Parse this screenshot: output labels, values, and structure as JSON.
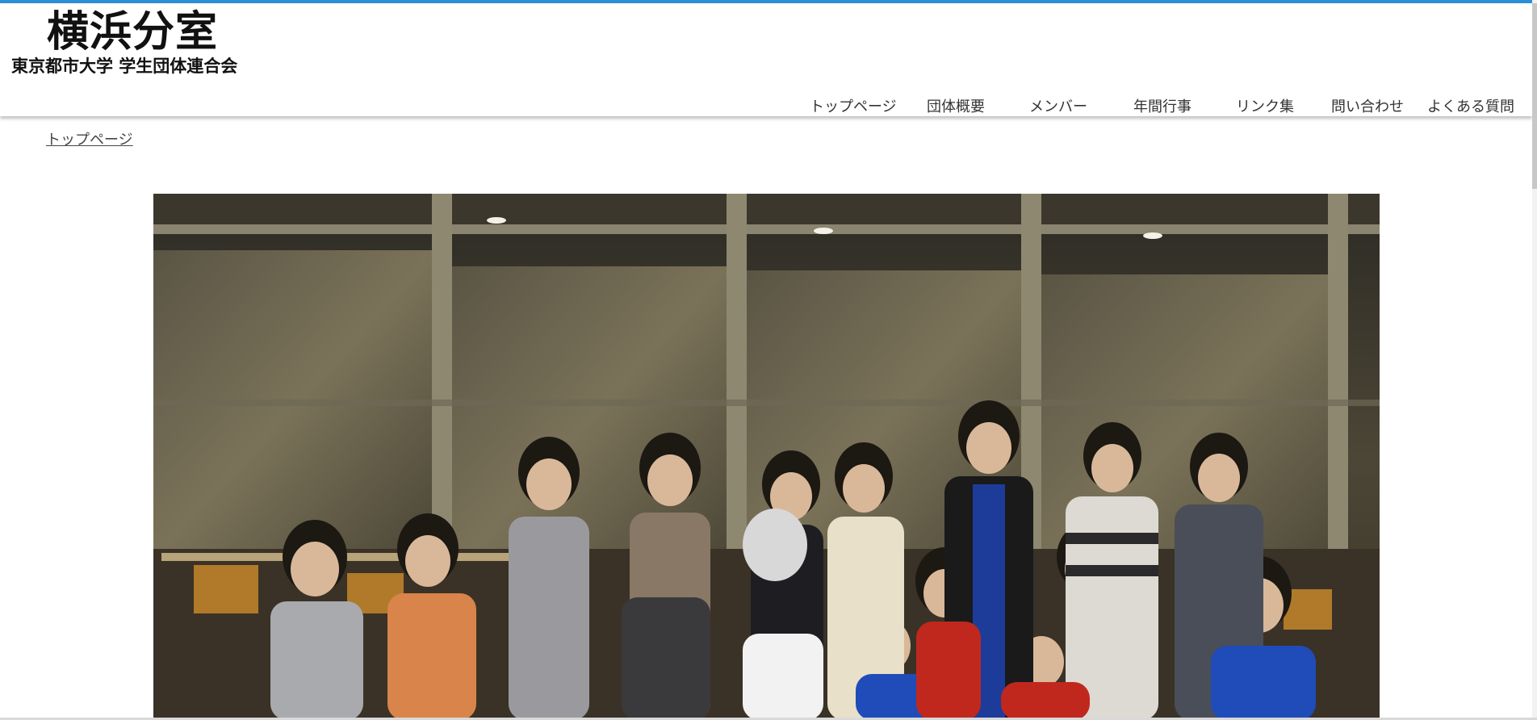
{
  "site": {
    "title": "横浜分室",
    "subtitle": "東京都市大学 学生団体連合会"
  },
  "nav": {
    "items": [
      {
        "label": "トップページ"
      },
      {
        "label": "団体概要"
      },
      {
        "label": "メンバー"
      },
      {
        "label": "年間行事"
      },
      {
        "label": "リンク集"
      },
      {
        "label": "問い合わせ"
      },
      {
        "label": "よくある質問"
      }
    ]
  },
  "breadcrumb": {
    "label": "トップページ"
  },
  "hero": {
    "image": "group-photo"
  },
  "colors": {
    "accent": "#2a8fd6",
    "text": "#333333"
  }
}
